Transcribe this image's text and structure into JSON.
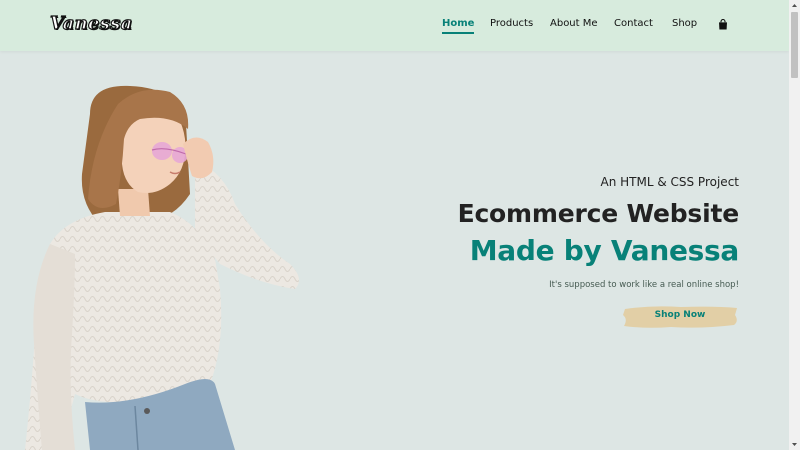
{
  "brand": {
    "logo_text": "Vanessa"
  },
  "nav": {
    "items": [
      {
        "label": "Home",
        "active": true
      },
      {
        "label": "Products",
        "active": false
      },
      {
        "label": "About Me",
        "active": false
      },
      {
        "label": "Contact",
        "active": false
      },
      {
        "label": "Shop",
        "active": false
      }
    ],
    "cart_icon": "shopping-bag-icon"
  },
  "hero": {
    "eyebrow": "An HTML & CSS Project",
    "title": "Ecommerce Website",
    "subtitle": "Made by Vanessa",
    "tagline": "It's supposed to work like a real online shop!",
    "cta_label": "Shop Now",
    "image": "woman-in-white-sweater-with-pink-sunglasses"
  },
  "colors": {
    "accent": "#088178",
    "header_bg": "#d7ebdd",
    "hero_bg": "#dde6e4",
    "button_bg": "#e2cfa6",
    "text": "#222222"
  }
}
